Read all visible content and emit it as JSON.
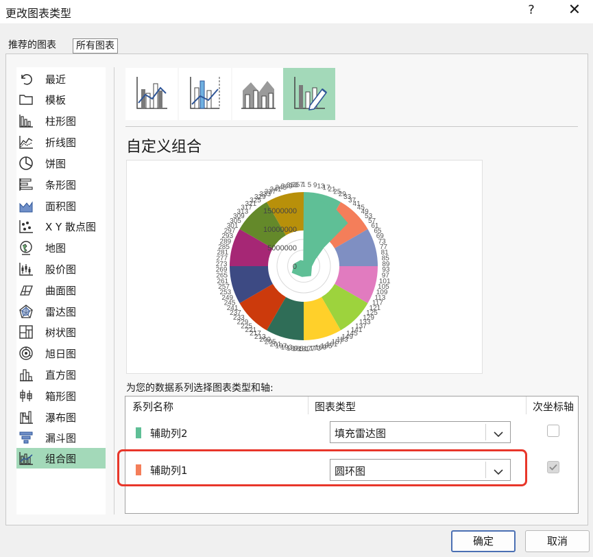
{
  "window": {
    "title": "更改图表类型",
    "help": "?",
    "close": "✕"
  },
  "tabs": [
    {
      "label": "推荐的图表"
    },
    {
      "label": "所有图表"
    }
  ],
  "sidebar": {
    "selected": "组合图",
    "items": [
      {
        "label": "最近",
        "icon": "recent-icon"
      },
      {
        "label": "模板",
        "icon": "folder-icon"
      },
      {
        "label": "柱形图",
        "icon": "column-chart-icon"
      },
      {
        "label": "折线图",
        "icon": "line-chart-icon"
      },
      {
        "label": "饼图",
        "icon": "pie-chart-icon"
      },
      {
        "label": "条形图",
        "icon": "bar-chart-icon"
      },
      {
        "label": "面积图",
        "icon": "area-chart-icon"
      },
      {
        "label": "X Y 散点图",
        "icon": "scatter-chart-icon"
      },
      {
        "label": "地图",
        "icon": "globe-icon"
      },
      {
        "label": "股价图",
        "icon": "stock-chart-icon"
      },
      {
        "label": "曲面图",
        "icon": "surface-chart-icon"
      },
      {
        "label": "雷达图",
        "icon": "radar-chart-icon"
      },
      {
        "label": "树状图",
        "icon": "treemap-icon"
      },
      {
        "label": "旭日图",
        "icon": "sunburst-icon"
      },
      {
        "label": "直方图",
        "icon": "histogram-icon"
      },
      {
        "label": "箱形图",
        "icon": "box-whisker-icon"
      },
      {
        "label": "瀑布图",
        "icon": "waterfall-icon"
      },
      {
        "label": "漏斗图",
        "icon": "funnel-icon"
      },
      {
        "label": "组合图",
        "icon": "combo-chart-icon"
      }
    ]
  },
  "combo_types": [
    {
      "name": "clustered-column-line",
      "icon": "combo-column-line-icon"
    },
    {
      "name": "clustered-column-line-secondary",
      "icon": "combo-column-line-secondary-icon"
    },
    {
      "name": "stacked-area-column",
      "icon": "combo-area-column-icon"
    },
    {
      "name": "custom-combination",
      "icon": "combo-custom-icon",
      "selected": true
    }
  ],
  "section_title": "自定义组合",
  "preview": {
    "donut_segment_colors": [
      "#5fbf96",
      "#f47e5a",
      "#7f8fc2",
      "#e17bbf",
      "#9dd33d",
      "#ffd02a",
      "#2f6d57",
      "#cc3a0c",
      "#3d4a83",
      "#a62775",
      "#64892a",
      "#b8900a"
    ],
    "radar_color": "#5fbf96",
    "scale_labels": [
      "0",
      "5000000",
      "10000000",
      "15000000"
    ],
    "ring_labels": [
      "1",
      "5",
      "9",
      "13",
      "17",
      "21",
      "25",
      "29",
      "33",
      "37",
      "41",
      "45",
      "49",
      "53",
      "57",
      "61",
      "65",
      "69",
      "73",
      "77",
      "81",
      "85",
      "89",
      "93",
      "97",
      "101",
      "105",
      "109",
      "113",
      "117",
      "121",
      "125",
      "129",
      "133",
      "137",
      "141",
      "145",
      "149",
      "153",
      "157",
      "161",
      "165",
      "169",
      "173",
      "177",
      "181",
      "185",
      "189",
      "193",
      "197",
      "201",
      "205",
      "209",
      "213",
      "217",
      "221",
      "225",
      "229",
      "233",
      "237",
      "241",
      "245",
      "249",
      "253",
      "257",
      "261",
      "265",
      "269",
      "273",
      "277",
      "281",
      "285",
      "289",
      "293",
      "297",
      "301",
      "305",
      "309",
      "313",
      "317",
      "321",
      "325",
      "329",
      "333",
      "337",
      "341",
      "345",
      "349",
      "353",
      "357"
    ]
  },
  "series_section_label": "为您的数据系列选择图表类型和轴:",
  "table": {
    "headers": {
      "name": "系列名称",
      "type": "图表类型",
      "axis": "次坐标轴"
    },
    "rows": [
      {
        "name": "辅助列2",
        "color": "#5fbf96",
        "chart_type": "填充雷达图",
        "secondary_axis": false
      },
      {
        "name": "辅助列1",
        "color": "#f47e5a",
        "chart_type": "圆环图",
        "secondary_axis": true
      }
    ]
  },
  "buttons": {
    "ok": "确定",
    "cancel": "取消"
  }
}
